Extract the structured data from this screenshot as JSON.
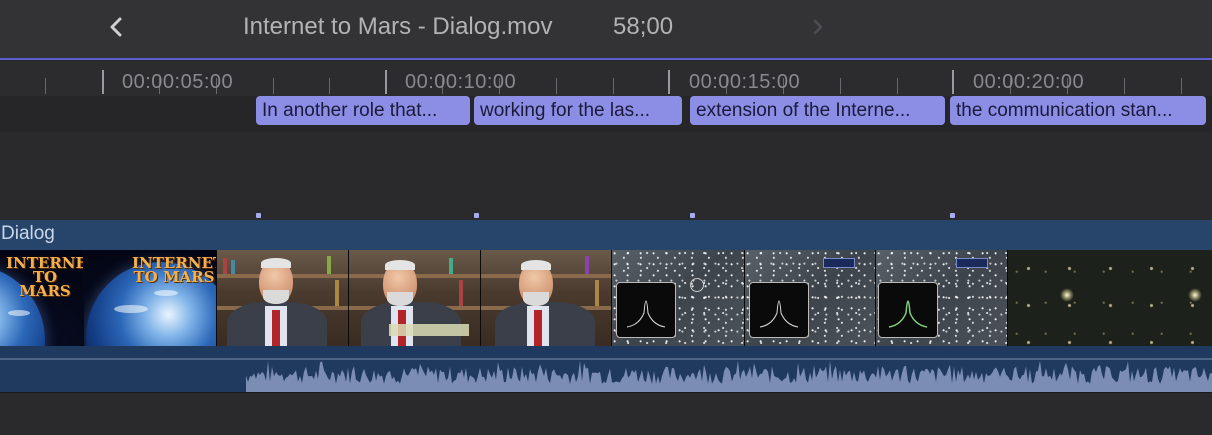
{
  "header": {
    "title": "Internet to Mars - Dialog.mov",
    "timecode": "58;00",
    "back_icon": "chevron-left-icon",
    "forward_icon": "chevron-right-icon"
  },
  "ruler": {
    "labels": [
      "00:00:05:00",
      "00:00:10:00",
      "00:00:15:00",
      "00:00:20:00"
    ]
  },
  "captions": [
    "In another role that...",
    "working for the las...",
    "extension of the Interne...",
    "the communication stan..."
  ],
  "track": {
    "label": "Dialog",
    "thumb_text": "INTERNET TO MARS"
  },
  "colors": {
    "accent": "#5a5fd0",
    "caption": "#8c8ee6",
    "track": "#27446b",
    "audio": "#1f3a5e"
  }
}
